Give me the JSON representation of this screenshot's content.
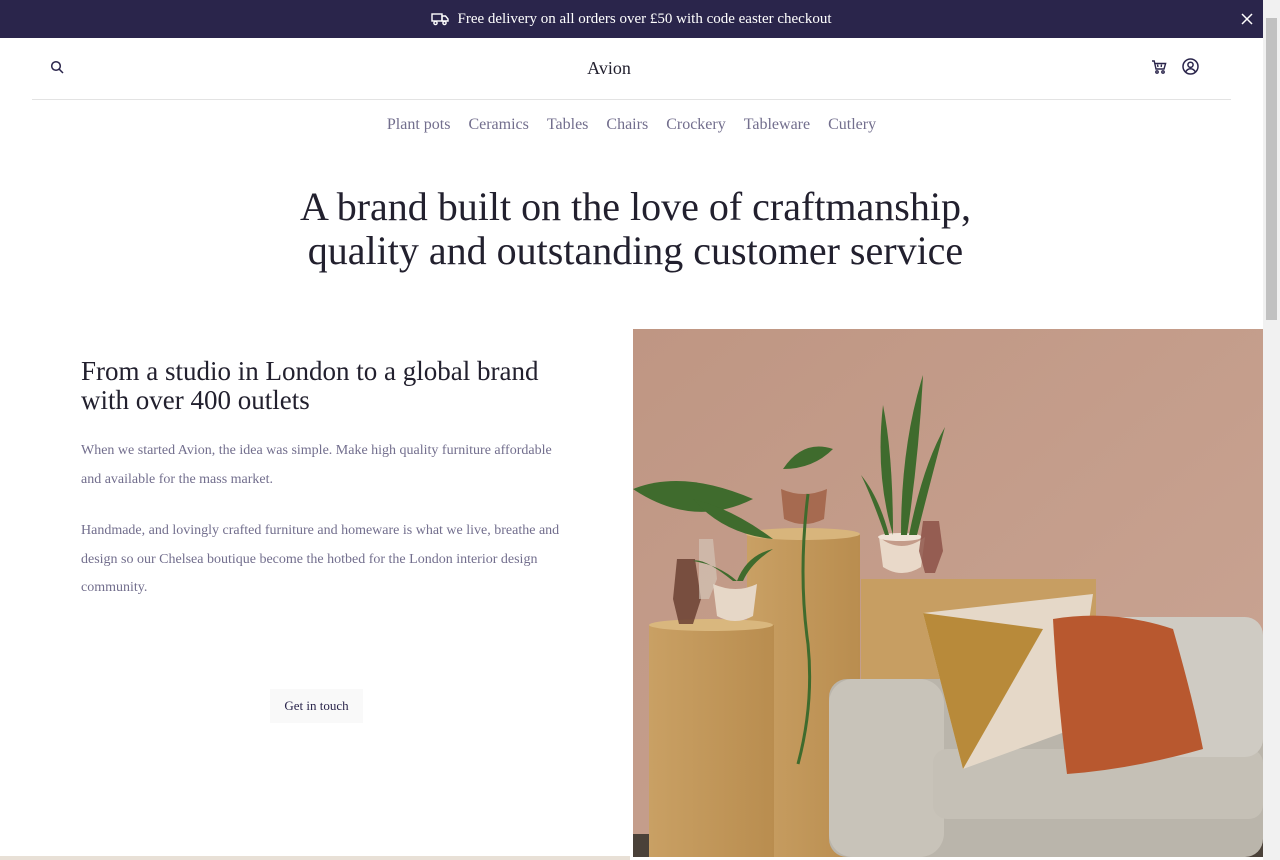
{
  "promo": {
    "message": "Free delivery on all orders over £50 with code easter checkout",
    "icon": "delivery-truck-icon",
    "close_icon": "close-icon"
  },
  "header": {
    "brand": "Avion",
    "icons": [
      "search-icon",
      "cart-icon",
      "user-account-icon"
    ]
  },
  "nav": {
    "items": [
      {
        "label": "Plant pots"
      },
      {
        "label": "Ceramics"
      },
      {
        "label": "Tables"
      },
      {
        "label": "Chairs"
      },
      {
        "label": "Crockery"
      },
      {
        "label": "Tableware"
      },
      {
        "label": "Cutlery"
      }
    ]
  },
  "hero": {
    "line1": "A brand built on the love of craftmanship,",
    "line2": "quality and outstanding customer service"
  },
  "story": {
    "heading": "From a studio in London to a global brand with over 400 outlets",
    "paragraph1": "When we started Avion, the idea was simple. Make high quality furniture affordable and available for the mass market.",
    "paragraph2": "Handmade, and lovingly crafted furniture and homeware is what we live, breathe and design so our Chelsea boutique become the hotbed for the London interior design community.",
    "cta_label": "Get in touch"
  },
  "colors": {
    "brand_dark": "#2a254b",
    "text_muted": "#726e8d",
    "button_bg": "#f9f9f9"
  }
}
